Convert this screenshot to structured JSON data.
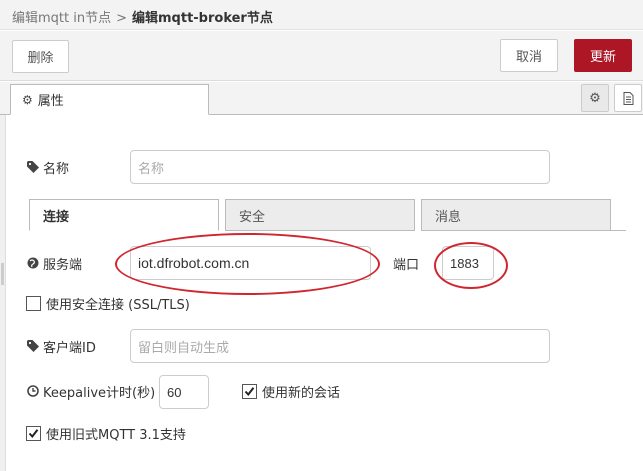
{
  "breadcrumb": {
    "previous": "编辑mqtt in节点",
    "separator": ">",
    "current": "编辑mqtt-broker节点"
  },
  "toolbar": {
    "delete_label": "删除",
    "cancel_label": "取消",
    "update_label": "更新"
  },
  "tabs": {
    "properties_label": "属性"
  },
  "form": {
    "name": {
      "label": "名称",
      "placeholder": "名称",
      "value": ""
    },
    "subtabs": [
      "连接",
      "安全",
      "消息"
    ],
    "server": {
      "label": "服务端",
      "value": "iot.dfrobot.com.cn"
    },
    "port": {
      "label": "端口",
      "value": "1883"
    },
    "tls": {
      "label": "使用安全连接 (SSL/TLS)",
      "checked": false
    },
    "client_id": {
      "label": "客户端ID",
      "placeholder": "留白则自动生成",
      "value": ""
    },
    "keepalive": {
      "label": "Keepalive计时(秒)",
      "value": "60"
    },
    "clean_session": {
      "label": "使用新的会话",
      "checked": true
    },
    "legacy_mqtt": {
      "label": "使用旧式MQTT 3.1支持",
      "checked": true
    }
  },
  "colors": {
    "accent": "#ad1625",
    "annotation": "#d0262f"
  },
  "icons": [
    "gear-icon",
    "description-icon",
    "tag-icon",
    "globe-icon",
    "clock-icon"
  ]
}
